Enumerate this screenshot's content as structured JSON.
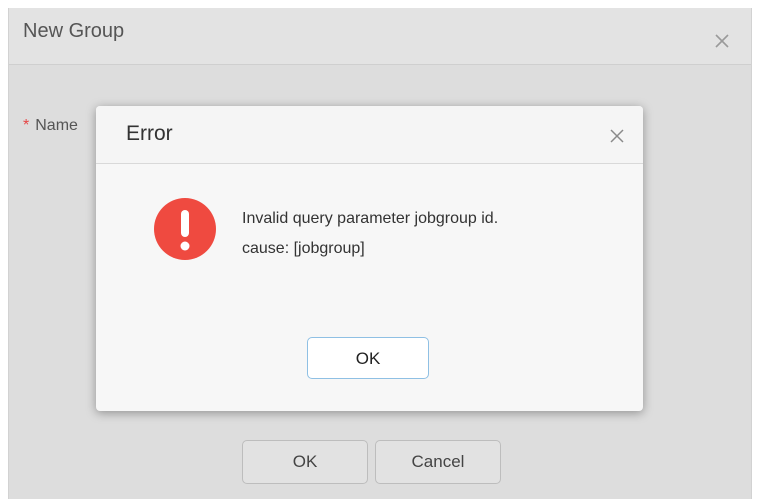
{
  "background_dialog": {
    "title": "New Group",
    "close_icon": "close-icon",
    "form": {
      "name_label": "Name",
      "required_marker": "*",
      "name_value": ""
    },
    "buttons": {
      "ok_label": "OK",
      "cancel_label": "Cancel"
    }
  },
  "error_dialog": {
    "title": "Error",
    "close_icon": "close-icon",
    "icon": "error-exclamation-icon",
    "message_line1": "Invalid query parameter jobgroup id.",
    "message_line2": "cause: [jobgroup]",
    "ok_label": "OK"
  },
  "colors": {
    "error_icon": "#ef4a40",
    "ok_border": "#8fc0e4",
    "required": "#e64545"
  }
}
